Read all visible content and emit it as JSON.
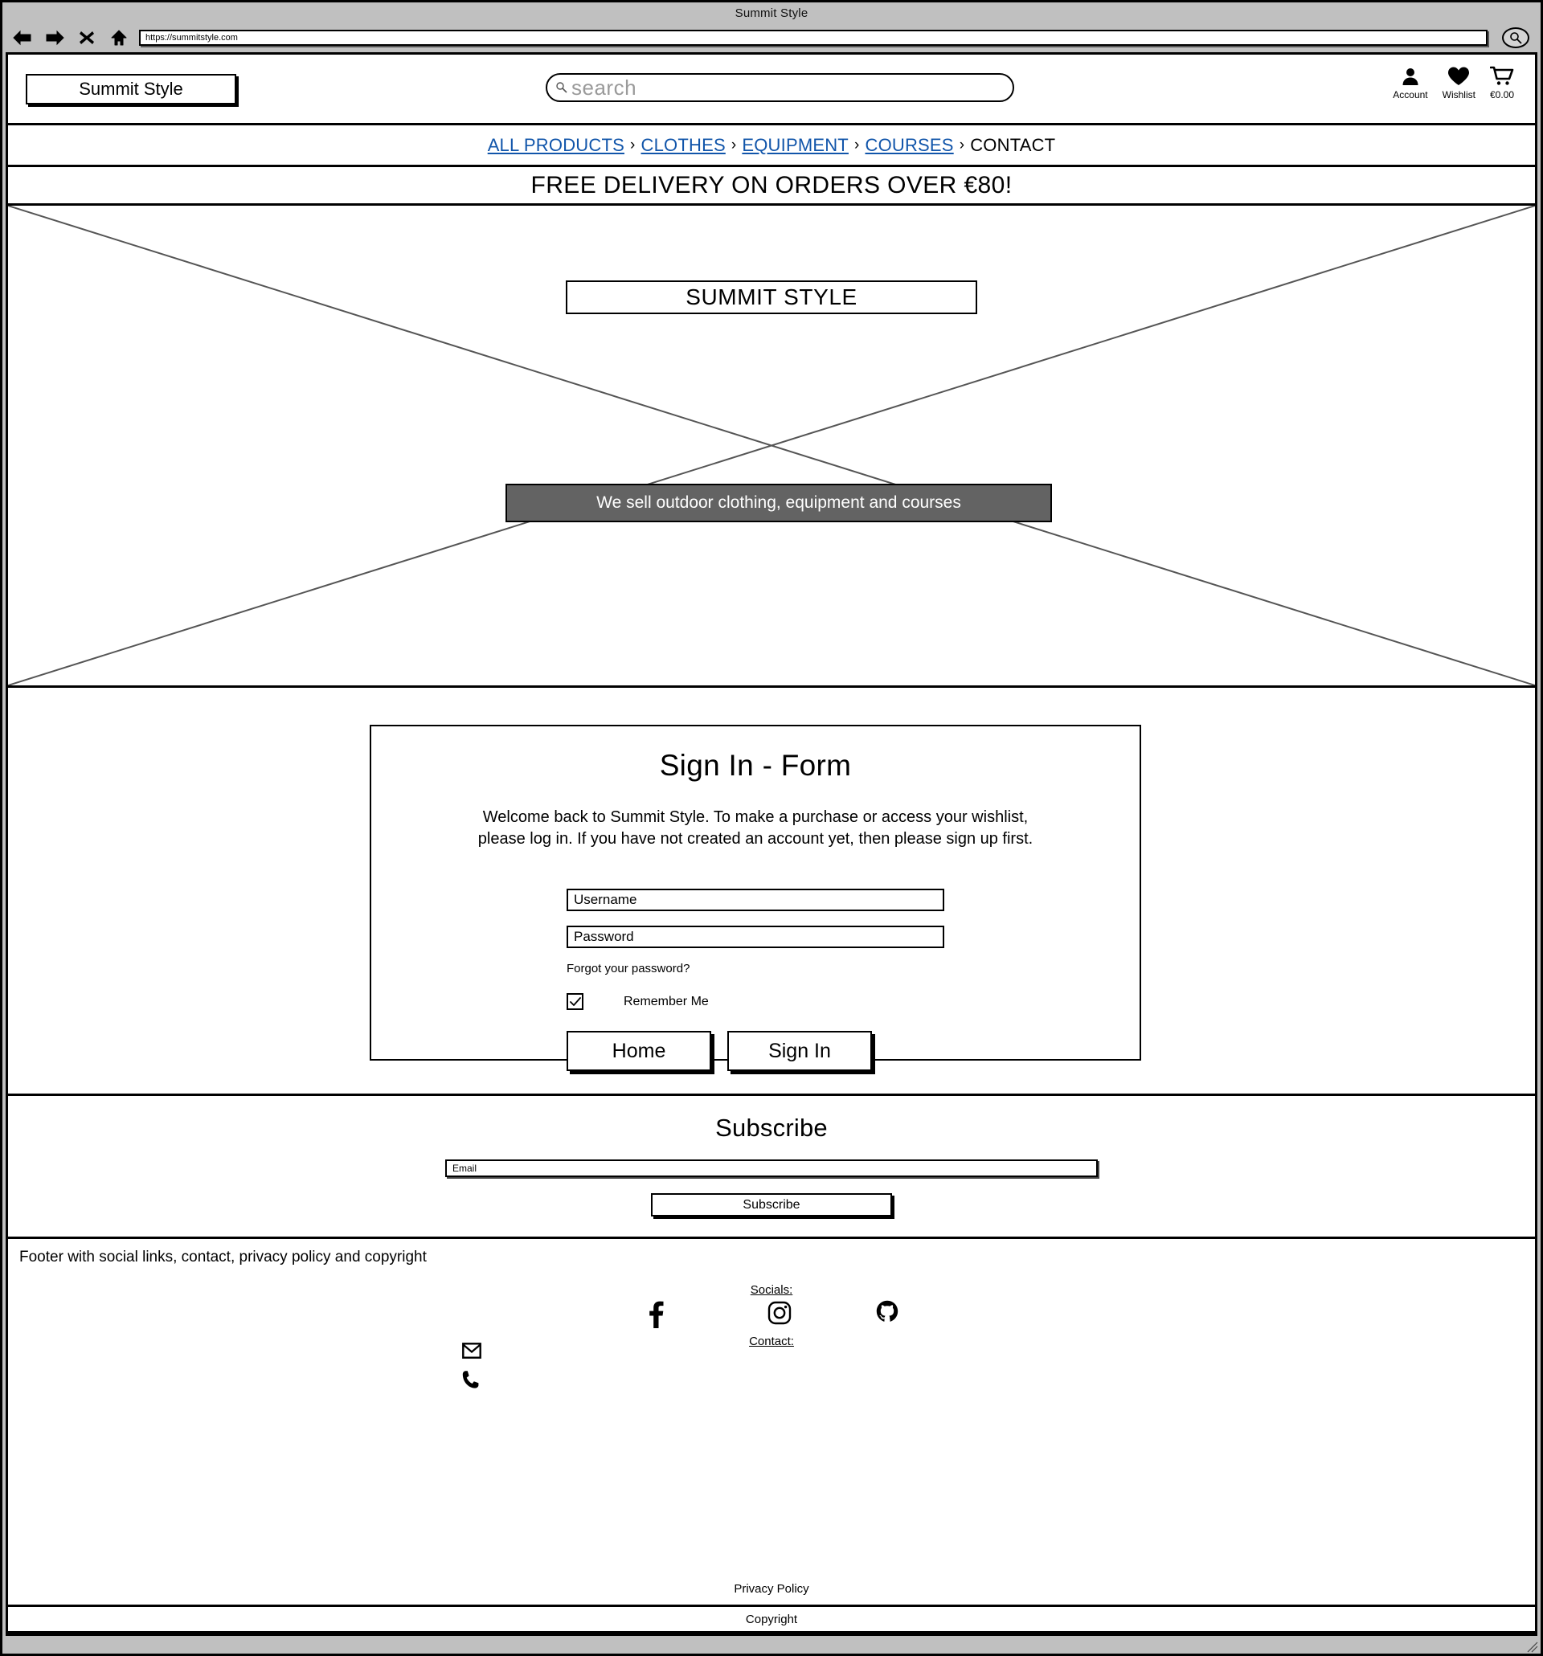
{
  "browser": {
    "window_title": "Summit Style",
    "url": "https://summitstyle.com",
    "back_icon": "back-arrow-icon",
    "forward_icon": "forward-arrow-icon",
    "stop_icon": "stop-x-icon",
    "home_icon": "home-icon",
    "search_icon": "search-icon"
  },
  "header": {
    "logo": "Summit Style",
    "search_placeholder": "search",
    "actions": [
      {
        "icon": "account-person-icon",
        "label": "Account"
      },
      {
        "icon": "wishlist-heart-icon",
        "label": "Wishlist"
      },
      {
        "icon": "cart-icon",
        "label": "€0.00"
      }
    ]
  },
  "breadcrumb": {
    "separator": "›",
    "items": [
      {
        "label": "ALL PRODUCTS",
        "current": false
      },
      {
        "label": "CLOTHES",
        "current": false
      },
      {
        "label": "EQUIPMENT",
        "current": false
      },
      {
        "label": "COURSES",
        "current": false
      },
      {
        "label": "CONTACT",
        "current": true
      }
    ],
    "link_color": "#1155aa",
    "current_color": "#000000"
  },
  "delivery_banner": {
    "text": "FREE DELIVERY ON ORDERS OVER €80!"
  },
  "hero": {
    "title": "SUMMIT STYLE",
    "tagline": "We sell outdoor clothing, equipment and courses",
    "tagline_bg": "#636363",
    "tagline_color": "#ffffff"
  },
  "sign_in": {
    "title": "Sign In - Form",
    "intro_line1": "Welcome back to Summit Style. To make a purchase or access your wishlist,",
    "intro_line2": "please log in. If you have not created an account yet, then please sign up first.",
    "username_value": "Username",
    "password_value": "Password",
    "forgot_label": "Forgot your password?",
    "remember_label": "Remember Me",
    "remember_checked": true,
    "home_button": "Home",
    "signin_button": "Sign In"
  },
  "subscribe": {
    "title": "Subscribe",
    "email_value": "Email",
    "button_label": "Subscribe"
  },
  "footer": {
    "note": "Footer with social links, contact, privacy policy and copyright",
    "socials_label": "Socials:",
    "contact_label": "Contact:",
    "socials": [
      {
        "icon": "facebook-icon"
      },
      {
        "icon": "instagram-icon"
      },
      {
        "icon": "github-icon"
      }
    ],
    "contacts": [
      {
        "icon": "email-envelope-icon"
      },
      {
        "icon": "phone-icon"
      }
    ],
    "privacy_policy": "Privacy Policy",
    "copyright": "Copyright"
  }
}
